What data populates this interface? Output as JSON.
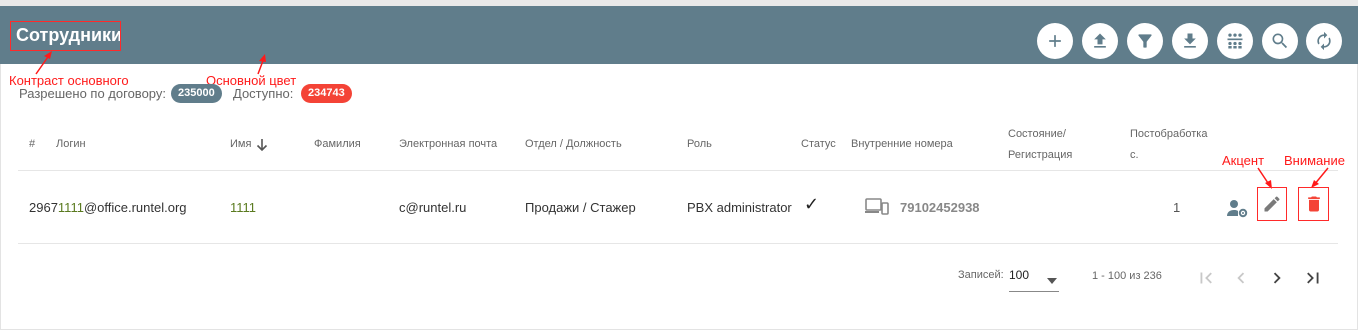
{
  "header": {
    "title": "Сотрудники",
    "bg_color": "#607d8b",
    "buttons": [
      "add-icon",
      "upload-icon",
      "filter-icon",
      "download-icon",
      "group-icon",
      "search-icon",
      "refresh-icon"
    ]
  },
  "annotations": {
    "contrast": "Контраст основного",
    "primary": "Основной цвет",
    "accent": "Акцент",
    "warn": "Внимание"
  },
  "quota": {
    "allowed_label": "Разрешено по договору:",
    "allowed_value": "235000",
    "available_label": "Доступно:",
    "available_value": "234743",
    "allowed_color": "#607d8b",
    "available_color": "#f44336"
  },
  "table": {
    "headers": {
      "num": "#",
      "login": "Логин",
      "name": "Имя",
      "surname": "Фамилия",
      "email": "Электронная почта",
      "dept": "Отдел / Должность",
      "role": "Роль",
      "status": "Статус",
      "ext": "Внутренние номера",
      "state1": "Состояние/",
      "state2": "Регистрация",
      "post1": "Постобработка",
      "post2": "с."
    },
    "rows": [
      {
        "login_prefix": "2967",
        "login_highlight": "1111",
        "login_suffix": "@office.runtel.org",
        "name": "1111",
        "surname": "",
        "email": "c@runtel.ru",
        "dept": "Продажи / Стажер",
        "role": "PBX administrator",
        "status": "✓",
        "ext": "79102452938",
        "postprocessing": "1"
      }
    ]
  },
  "pagination": {
    "records_label": "Записей:",
    "page_size": "100",
    "range": "1 - 100 из 236"
  }
}
